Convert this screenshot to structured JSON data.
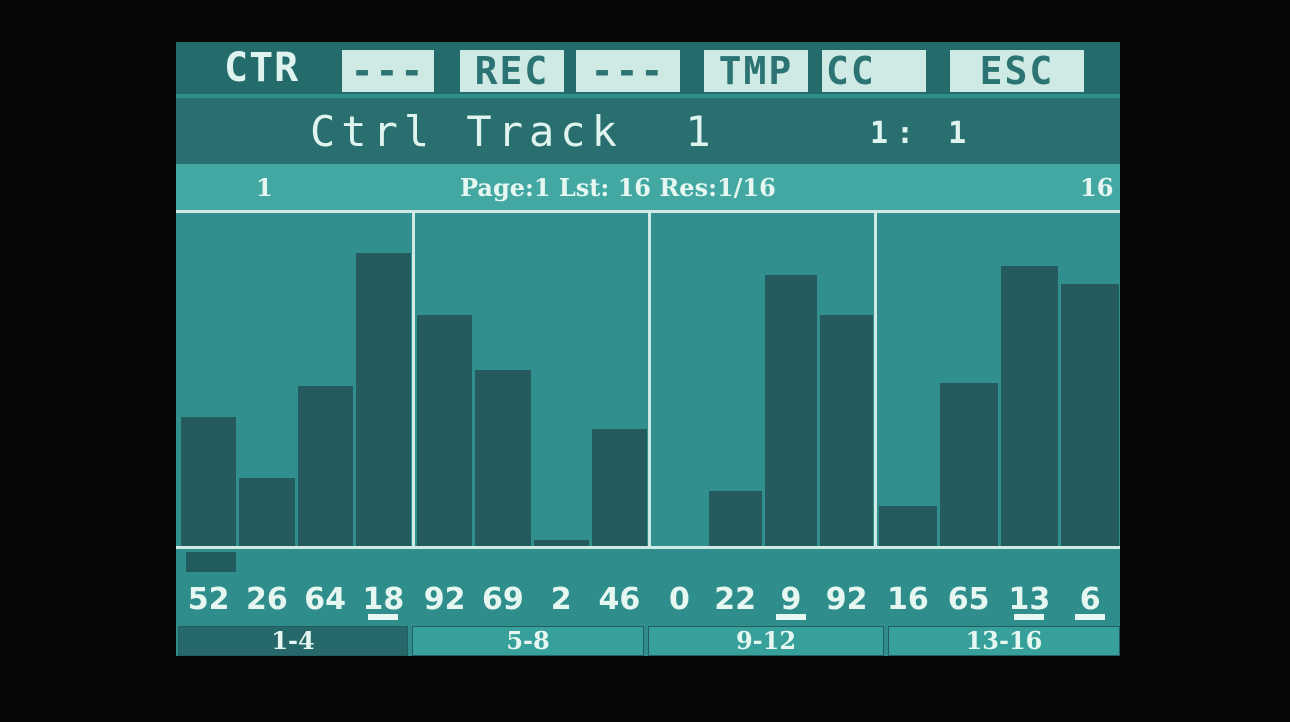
{
  "header": {
    "mode_label": "CTR",
    "buttons": [
      {
        "label": "---"
      },
      {
        "label": "REC"
      },
      {
        "label": "---"
      },
      {
        "label": "TMP"
      },
      {
        "label": "CC"
      },
      {
        "label": "ESC"
      }
    ]
  },
  "title": {
    "text": "Ctrl Track  1",
    "position": "1: 1"
  },
  "info": {
    "first_step": "1",
    "page_info": "Page:1 Lst: 16 Res:1/16",
    "last_step": "16"
  },
  "steps": [
    {
      "label": "52",
      "selected": false
    },
    {
      "label": "26",
      "selected": false
    },
    {
      "label": "64",
      "selected": false
    },
    {
      "label": "18",
      "selected": true
    },
    {
      "label": "92",
      "selected": false
    },
    {
      "label": "69",
      "selected": false
    },
    {
      "label": "2",
      "selected": false
    },
    {
      "label": "46",
      "selected": false
    },
    {
      "label": "0",
      "selected": false
    },
    {
      "label": "22",
      "selected": false
    },
    {
      "label": "9",
      "selected": true
    },
    {
      "label": "92",
      "selected": false
    },
    {
      "label": "16",
      "selected": false
    },
    {
      "label": "65",
      "selected": false
    },
    {
      "label": "13",
      "selected": true
    },
    {
      "label": "6",
      "selected": true
    }
  ],
  "bar_levels": [
    0.42,
    0.22,
    0.52,
    0.95,
    0.75,
    0.57,
    0.02,
    0.38,
    0.0,
    0.18,
    0.88,
    0.75,
    0.13,
    0.53,
    0.91,
    0.85
  ],
  "tabs": [
    {
      "label": "1-4",
      "active": true
    },
    {
      "label": "5-8",
      "active": false
    },
    {
      "label": "9-12",
      "active": false
    },
    {
      "label": "13-16",
      "active": false
    }
  ],
  "colors": {
    "screen_bg": "#2f8e8c",
    "bar": "#255a5e",
    "text": "#e6f7f2",
    "button_bg": "#cfe9e4"
  }
}
